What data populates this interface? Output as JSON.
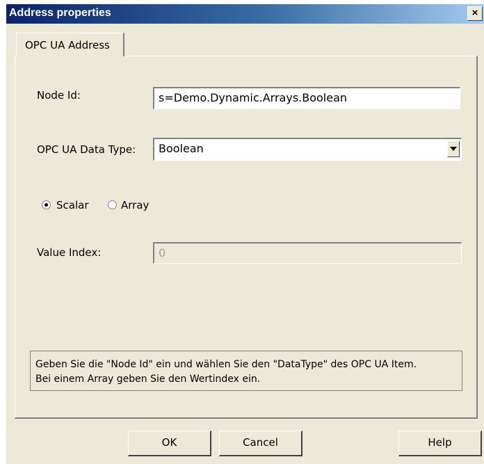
{
  "window": {
    "title": "Address properties",
    "close_glyph": "×"
  },
  "tabs": [
    {
      "label": "OPC UA Address",
      "active": true
    }
  ],
  "form": {
    "node_id": {
      "label": "Node Id:",
      "value": "s=Demo.Dynamic.Arrays.Boolean"
    },
    "data_type": {
      "label": "OPC UA Data Type:",
      "value": "Boolean"
    },
    "kind": {
      "options": [
        {
          "label": "Scalar",
          "checked": true
        },
        {
          "label": "Array",
          "checked": false
        }
      ]
    },
    "value_index": {
      "label": "Value Index:",
      "value": "0",
      "disabled": true
    }
  },
  "hint": {
    "line1": "Geben Sie die \"Node Id\" ein und wählen Sie den \"DataType\" des OPC UA Item.",
    "line2": "Bei einem Array geben Sie den Wertindex ein."
  },
  "buttons": {
    "ok": "OK",
    "cancel": "Cancel",
    "help": "Help"
  },
  "icons": {
    "dropdown": "chevron-down-icon",
    "close": "close-icon"
  }
}
